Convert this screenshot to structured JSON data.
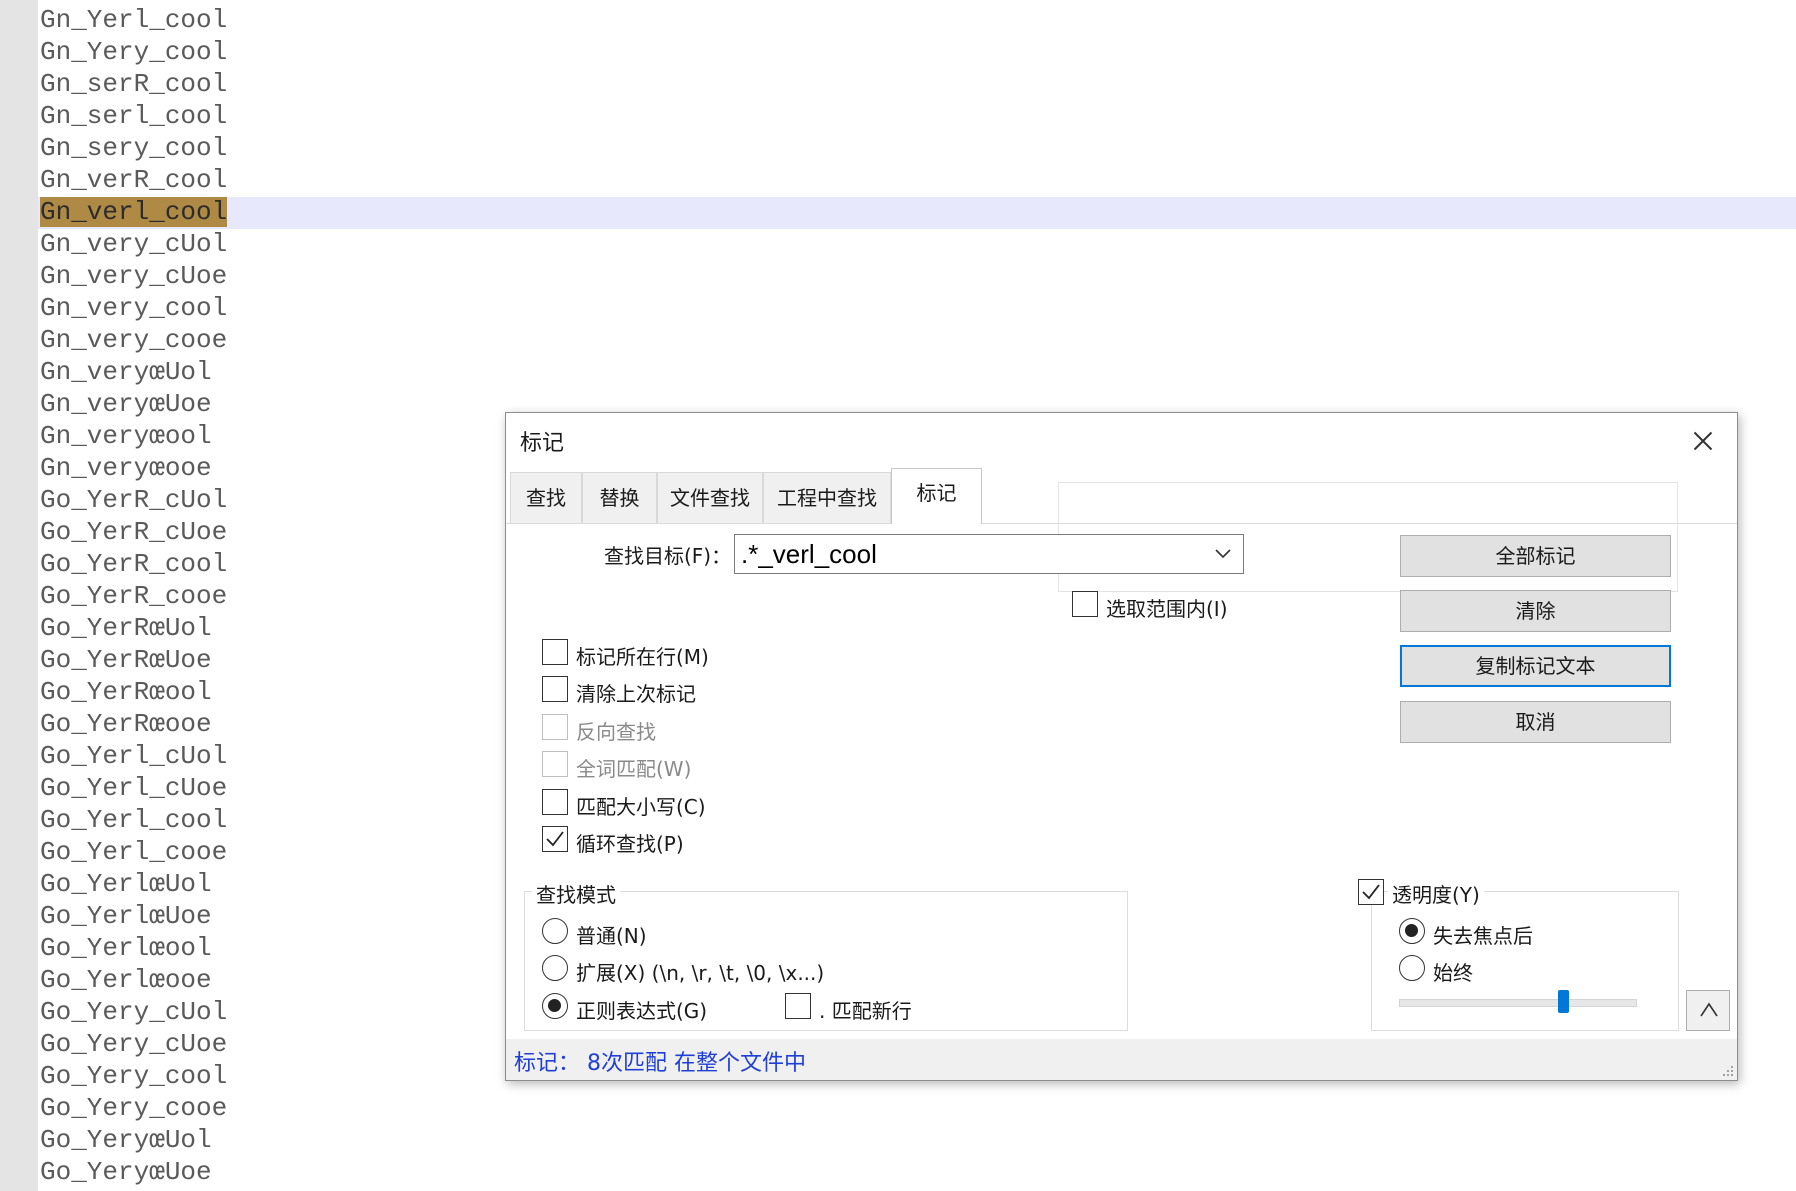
{
  "editor": {
    "current_line_index": 6,
    "lines": [
      "Gn_Yerl_cool",
      "Gn_Yery_cool",
      "Gn_serR_cool",
      "Gn_serl_cool",
      "Gn_sery_cool",
      "Gn_verR_cool",
      "Gn_verl_cool",
      "Gn_very_cUol",
      "Gn_very_cUoe",
      "Gn_very_cool",
      "Gn_very_cooe",
      "Gn_veryœUol",
      "Gn_veryœUoe",
      "Gn_veryœool",
      "Gn_veryœooe",
      "Go_YerR_cUol",
      "Go_YerR_cUoe",
      "Go_YerR_cool",
      "Go_YerR_cooe",
      "Go_YerRœUol",
      "Go_YerRœUoe",
      "Go_YerRœool",
      "Go_YerRœooe",
      "Go_Yerl_cUol",
      "Go_Yerl_cUoe",
      "Go_Yerl_cool",
      "Go_Yerl_cooe",
      "Go_YerlœUol",
      "Go_YerlœUoe",
      "Go_Yerlœool",
      "Go_Yerlœooe",
      "Go_Yery_cUol",
      "Go_Yery_cUoe",
      "Go_Yery_cool",
      "Go_Yery_cooe",
      "Go_YeryœUol",
      "Go_YeryœUoe"
    ],
    "highlight_color": "#ae8a44"
  },
  "dialog": {
    "title": "标记",
    "tabs": [
      "查找",
      "替换",
      "文件查找",
      "工程中查找",
      "标记"
    ],
    "active_tab": "标记",
    "find_label": "查找目标(F)：",
    "find_value": ".*_verl_cool",
    "in_selection_label": "选取范围内(I)",
    "buttons": {
      "mark_all": "全部标记",
      "clear": "清除",
      "copy_marked": "复制标记文本",
      "cancel": "取消"
    },
    "options": {
      "bookmark_line": {
        "label": "标记所在行(M)",
        "checked": false
      },
      "purge": {
        "label": "清除上次标记",
        "checked": false
      },
      "backward": {
        "label": "反向查找",
        "checked": false,
        "disabled": true
      },
      "whole_word": {
        "label": "全词匹配(W)",
        "checked": false,
        "disabled": true
      },
      "match_case": {
        "label": "匹配大小写(C)",
        "checked": false
      },
      "wrap_around": {
        "label": "循环查找(P)",
        "checked": true
      }
    },
    "search_mode": {
      "title": "查找模式",
      "normal": "普通(N)",
      "extended": "扩展(X) (\\n, \\r, \\t, \\0, \\x...)",
      "regex": "正则表达式(G)",
      "selected": "regex",
      "dot_newline": ". 匹配新行"
    },
    "transparency": {
      "title": "透明度(Y)",
      "enabled": true,
      "on_lose_focus": "失去焦点后",
      "always": "始终",
      "selected": "on_lose_focus",
      "level_fraction": 0.7
    },
    "status": "标记：   8次匹配 在整个文件中",
    "accent_color": "#0078d7",
    "status_color": "#1f3fd6"
  }
}
